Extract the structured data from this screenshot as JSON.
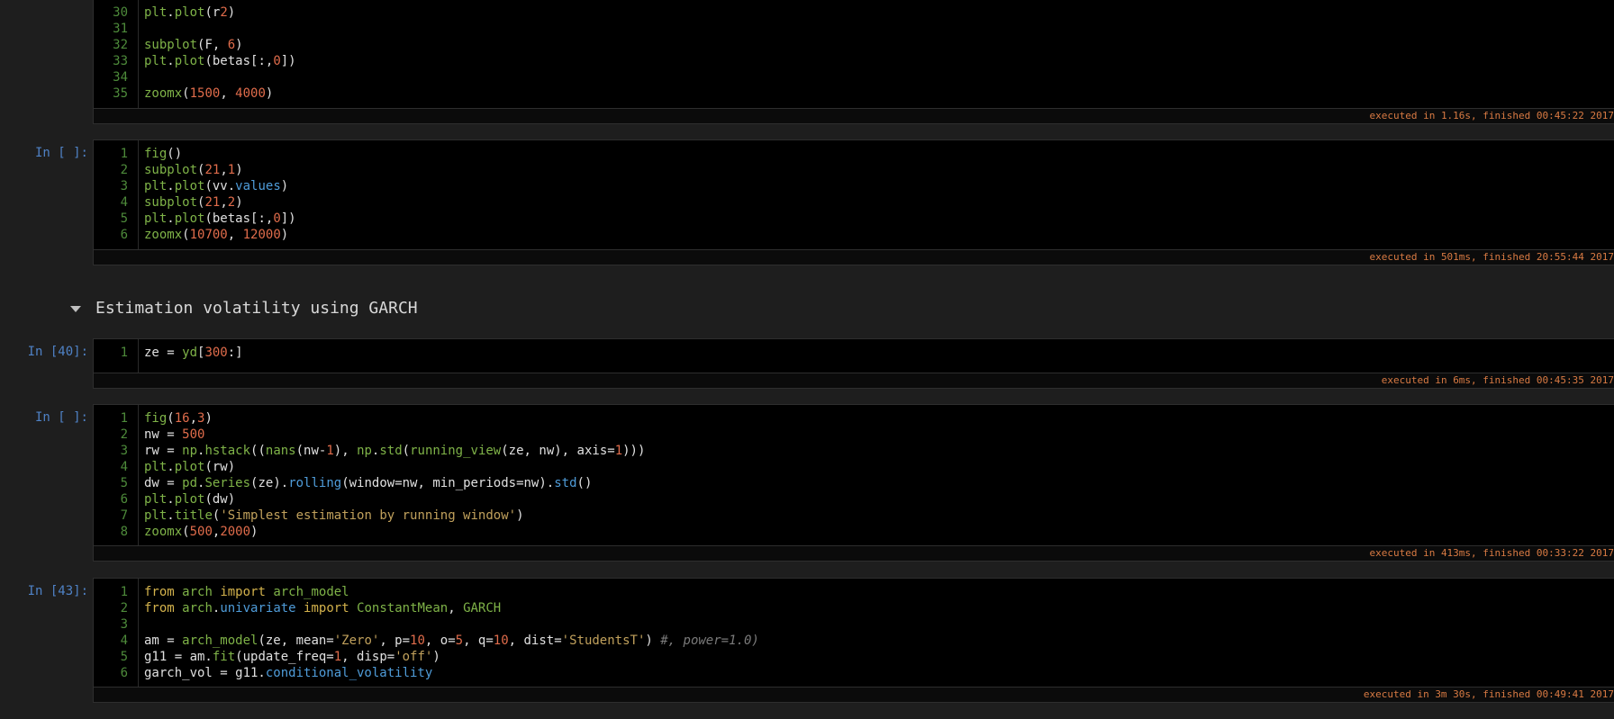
{
  "colors": {
    "background": "#1e1e1e",
    "cell_bg": "#000000",
    "prompt": "#4f82c6",
    "line_number": "#4d8a3a",
    "code_plain": "#e0e0e0",
    "code_func": "#7fb348",
    "code_attr": "#4f9cd9",
    "code_number": "#e06c4b",
    "code_string": "#c1a15c",
    "code_keyword": "#d3b24c",
    "code_comment": "#7a7a7a",
    "status": "#d87a43"
  },
  "cells": [
    {
      "id": "cell-top",
      "prompt": "",
      "lines": [
        {
          "n": "30",
          "tokens": [
            [
              "f",
              "plt"
            ],
            [
              "p",
              "."
            ],
            [
              "f",
              "plot"
            ],
            [
              "p",
              "(r"
            ],
            [
              "n",
              "2"
            ],
            [
              "p",
              ")"
            ]
          ]
        },
        {
          "n": "31",
          "tokens": []
        },
        {
          "n": "32",
          "tokens": [
            [
              "f",
              "subplot"
            ],
            [
              "p",
              "(F, "
            ],
            [
              "n",
              "6"
            ],
            [
              "p",
              ")"
            ]
          ]
        },
        {
          "n": "33",
          "tokens": [
            [
              "f",
              "plt"
            ],
            [
              "p",
              "."
            ],
            [
              "f",
              "plot"
            ],
            [
              "p",
              "(betas[:,"
            ],
            [
              "n",
              "0"
            ],
            [
              "p",
              "])"
            ]
          ]
        },
        {
          "n": "34",
          "tokens": []
        },
        {
          "n": "35",
          "tokens": [
            [
              "f",
              "zoomx"
            ],
            [
              "p",
              "("
            ],
            [
              "n",
              "1500"
            ],
            [
              "p",
              ", "
            ],
            [
              "n",
              "4000"
            ],
            [
              "p",
              ")"
            ]
          ]
        }
      ],
      "status": "executed in 1.16s, finished 00:45:22 2017"
    },
    {
      "id": "cell-1",
      "prompt": "In [ ]:",
      "lines": [
        {
          "n": "1",
          "tokens": [
            [
              "f",
              "fig"
            ],
            [
              "p",
              "()"
            ]
          ]
        },
        {
          "n": "2",
          "tokens": [
            [
              "f",
              "subplot"
            ],
            [
              "p",
              "("
            ],
            [
              "n",
              "21"
            ],
            [
              "p",
              ","
            ],
            [
              "n",
              "1"
            ],
            [
              "p",
              ")"
            ]
          ]
        },
        {
          "n": "3",
          "tokens": [
            [
              "f",
              "plt"
            ],
            [
              "p",
              "."
            ],
            [
              "f",
              "plot"
            ],
            [
              "p",
              "(vv."
            ],
            [
              "a",
              "values"
            ],
            [
              "p",
              ")"
            ]
          ]
        },
        {
          "n": "4",
          "tokens": [
            [
              "f",
              "subplot"
            ],
            [
              "p",
              "("
            ],
            [
              "n",
              "21"
            ],
            [
              "p",
              ","
            ],
            [
              "n",
              "2"
            ],
            [
              "p",
              ")"
            ]
          ]
        },
        {
          "n": "5",
          "tokens": [
            [
              "f",
              "plt"
            ],
            [
              "p",
              "."
            ],
            [
              "f",
              "plot"
            ],
            [
              "p",
              "(betas[:,"
            ],
            [
              "n",
              "0"
            ],
            [
              "p",
              "])"
            ]
          ]
        },
        {
          "n": "6",
          "tokens": [
            [
              "f",
              "zoomx"
            ],
            [
              "p",
              "("
            ],
            [
              "n",
              "10700"
            ],
            [
              "p",
              ", "
            ],
            [
              "n",
              "12000"
            ],
            [
              "p",
              ")"
            ]
          ]
        }
      ],
      "status": "executed in 501ms, finished 20:55:44 2017"
    },
    {
      "id": "cell-2",
      "prompt": "In [40]:",
      "lines": [
        {
          "n": "1",
          "tokens": [
            [
              "p",
              "ze = "
            ],
            [
              "f",
              "yd"
            ],
            [
              "p",
              "["
            ],
            [
              "n",
              "300"
            ],
            [
              "p",
              ":]"
            ]
          ]
        }
      ],
      "status": "executed in 6ms, finished 00:45:35 2017"
    },
    {
      "id": "cell-3",
      "prompt": "In [ ]:",
      "lines": [
        {
          "n": "1",
          "tokens": [
            [
              "f",
              "fig"
            ],
            [
              "p",
              "("
            ],
            [
              "n",
              "16"
            ],
            [
              "p",
              ","
            ],
            [
              "n",
              "3"
            ],
            [
              "p",
              ")"
            ]
          ]
        },
        {
          "n": "2",
          "tokens": [
            [
              "p",
              "nw = "
            ],
            [
              "n",
              "500"
            ]
          ]
        },
        {
          "n": "3",
          "tokens": [
            [
              "p",
              "rw = "
            ],
            [
              "f",
              "np"
            ],
            [
              "p",
              "."
            ],
            [
              "f",
              "hstack"
            ],
            [
              "p",
              "(("
            ],
            [
              "f",
              "nans"
            ],
            [
              "p",
              "(nw-"
            ],
            [
              "n",
              "1"
            ],
            [
              "p",
              "), "
            ],
            [
              "f",
              "np"
            ],
            [
              "p",
              "."
            ],
            [
              "f",
              "std"
            ],
            [
              "p",
              "("
            ],
            [
              "f",
              "running_view"
            ],
            [
              "p",
              "(ze, nw), axis="
            ],
            [
              "n",
              "1"
            ],
            [
              "p",
              ")))"
            ]
          ]
        },
        {
          "n": "4",
          "tokens": [
            [
              "f",
              "plt"
            ],
            [
              "p",
              "."
            ],
            [
              "f",
              "plot"
            ],
            [
              "p",
              "(rw)"
            ]
          ]
        },
        {
          "n": "5",
          "tokens": [
            [
              "p",
              "dw = "
            ],
            [
              "f",
              "pd"
            ],
            [
              "p",
              "."
            ],
            [
              "f",
              "Series"
            ],
            [
              "p",
              "(ze)."
            ],
            [
              "a",
              "rolling"
            ],
            [
              "p",
              "(window=nw, min_periods=nw)."
            ],
            [
              "a",
              "std"
            ],
            [
              "p",
              "()"
            ]
          ]
        },
        {
          "n": "6",
          "tokens": [
            [
              "f",
              "plt"
            ],
            [
              "p",
              "."
            ],
            [
              "f",
              "plot"
            ],
            [
              "p",
              "(dw)"
            ]
          ]
        },
        {
          "n": "7",
          "tokens": [
            [
              "f",
              "plt"
            ],
            [
              "p",
              "."
            ],
            [
              "f",
              "title"
            ],
            [
              "p",
              "("
            ],
            [
              "s",
              "'Simplest estimation by running window'"
            ],
            [
              "p",
              ")"
            ]
          ]
        },
        {
          "n": "8",
          "tokens": [
            [
              "f",
              "zoomx"
            ],
            [
              "p",
              "("
            ],
            [
              "n",
              "500"
            ],
            [
              "p",
              ","
            ],
            [
              "n",
              "2000"
            ],
            [
              "p",
              ")"
            ]
          ]
        }
      ],
      "status": "executed in 413ms, finished 00:33:22 2017"
    },
    {
      "id": "cell-4",
      "prompt": "In [43]:",
      "lines": [
        {
          "n": "1",
          "tokens": [
            [
              "k",
              "from"
            ],
            [
              "p",
              " "
            ],
            [
              "f",
              "arch"
            ],
            [
              "p",
              " "
            ],
            [
              "k",
              "import"
            ],
            [
              "p",
              " "
            ],
            [
              "f",
              "arch_model"
            ]
          ]
        },
        {
          "n": "2",
          "tokens": [
            [
              "k",
              "from"
            ],
            [
              "p",
              " "
            ],
            [
              "f",
              "arch"
            ],
            [
              "p",
              "."
            ],
            [
              "a",
              "univariate"
            ],
            [
              "p",
              " "
            ],
            [
              "k",
              "import"
            ],
            [
              "p",
              " "
            ],
            [
              "f",
              "ConstantMean"
            ],
            [
              "p",
              ", "
            ],
            [
              "f",
              "GARCH"
            ]
          ]
        },
        {
          "n": "3",
          "tokens": []
        },
        {
          "n": "4",
          "tokens": [
            [
              "p",
              "am = "
            ],
            [
              "f",
              "arch_model"
            ],
            [
              "p",
              "(ze, mean="
            ],
            [
              "s",
              "'Zero'"
            ],
            [
              "p",
              ", p="
            ],
            [
              "n",
              "10"
            ],
            [
              "p",
              ", o="
            ],
            [
              "n",
              "5"
            ],
            [
              "p",
              ", q="
            ],
            [
              "n",
              "10"
            ],
            [
              "p",
              ", dist="
            ],
            [
              "s",
              "'StudentsT'"
            ],
            [
              "p",
              ") "
            ],
            [
              "c",
              "#, power=1.0)"
            ]
          ]
        },
        {
          "n": "5",
          "tokens": [
            [
              "p",
              "g11 = am."
            ],
            [
              "f",
              "fit"
            ],
            [
              "p",
              "(update_freq="
            ],
            [
              "n",
              "1"
            ],
            [
              "p",
              ", disp="
            ],
            [
              "s",
              "'off'"
            ],
            [
              "p",
              ")"
            ]
          ]
        },
        {
          "n": "6",
          "tokens": [
            [
              "p",
              "garch_vol = g11."
            ],
            [
              "a",
              "conditional_volatility"
            ]
          ]
        }
      ],
      "status": "executed in 3m 30s, finished 00:49:41 2017"
    }
  ],
  "heading": {
    "text": "Estimation volatility using GARCH",
    "toggle_icon": "caret-down-icon"
  }
}
